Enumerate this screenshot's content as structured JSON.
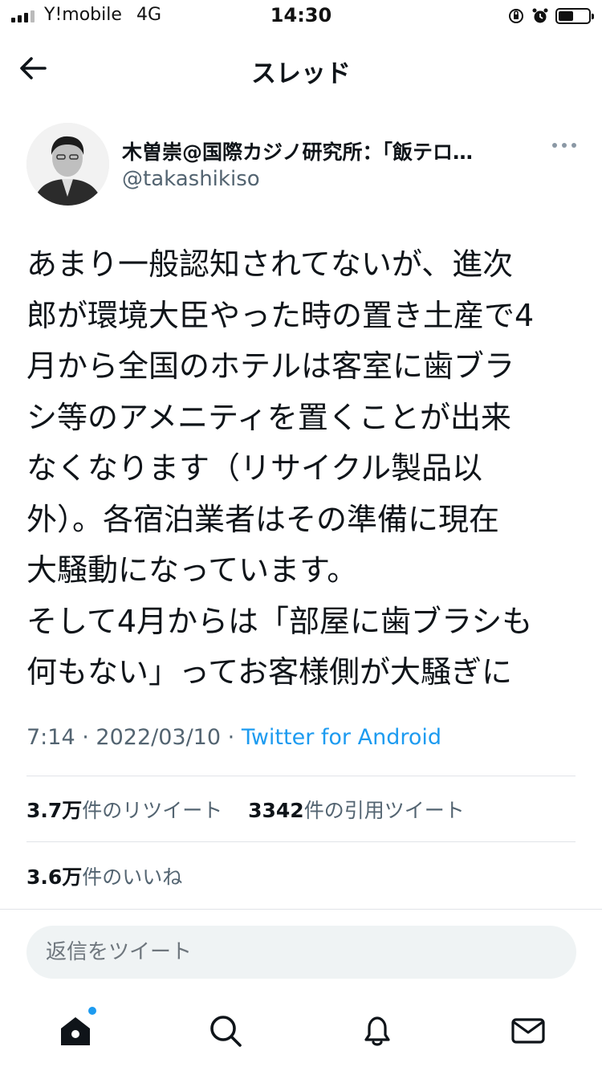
{
  "status_bar": {
    "carrier": "Y!mobile",
    "network": "4G",
    "time": "14:30"
  },
  "header": {
    "title": "スレッド",
    "back_icon": "arrow-left-icon"
  },
  "author": {
    "display_name": "木曽崇@国際カジノ研究所：「飯テロ…",
    "handle": "@takashikiso"
  },
  "tweet": {
    "lines": [
      "あまり一般認知されてないが、進次",
      "郎が環境大臣やった時の置き土産で4",
      "月から全国のホテルは客室に歯ブラ",
      "シ等のアメニティを置くことが出来",
      "なくなります（リサイクル製品以",
      "外）。各宿泊業者はその準備に現在",
      "大騒動になっています。",
      "そして4月からは「部屋に歯ブラシも",
      "何もない」ってお客様側が大騒ぎに"
    ],
    "time": "7:14",
    "date": "2022/03/10",
    "separator": "·",
    "source": "Twitter for Android"
  },
  "stats": {
    "retweets_count": "3.7万",
    "retweets_label": "件のリツイート",
    "quotes_count": "3342",
    "quotes_label": "件の引用ツイート",
    "likes_count": "3.6万",
    "likes_label": "件のいいね"
  },
  "reply": {
    "placeholder": "返信をツイート"
  },
  "tabbar": {
    "items": [
      "home-icon",
      "search-icon",
      "bell-icon",
      "mail-icon"
    ]
  },
  "colors": {
    "accent": "#1d9bf0",
    "secondary_text": "#536471",
    "divider": "#e1e4e8",
    "reply_bg": "#eff3f4"
  }
}
